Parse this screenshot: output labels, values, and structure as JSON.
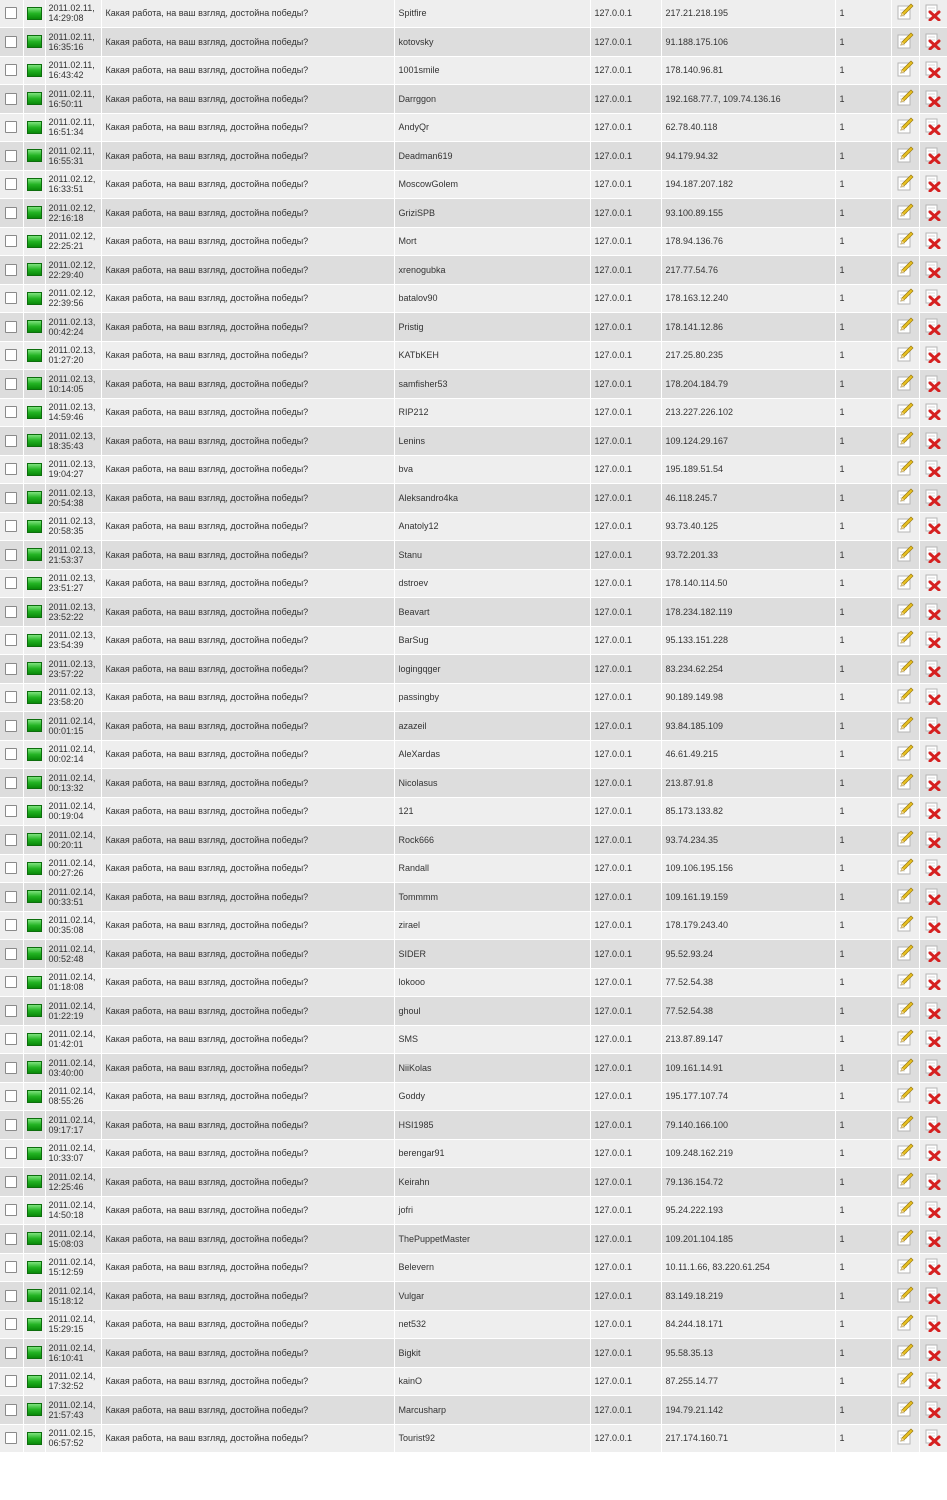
{
  "question": "Какая работа, на ваш взгляд, достойна победы?",
  "server_ip": "127.0.0.1",
  "icons": {
    "status": "green-status-icon",
    "edit": "edit-pencil-icon",
    "delete": "delete-cross-icon"
  },
  "colors": {
    "row_odd": "#eeeeee",
    "row_even": "#dddddd",
    "status_green": "#22b322",
    "delete_red": "#d62020",
    "pencil_yellow": "#e8c020"
  },
  "rows": [
    {
      "date": "2011.02.11,",
      "time": "14:29:08",
      "user": "Spitfire",
      "ip": "217.21.218.195",
      "count": "1"
    },
    {
      "date": "2011.02.11,",
      "time": "16:35:16",
      "user": "kotovsky",
      "ip": "91.188.175.106",
      "count": "1"
    },
    {
      "date": "2011.02.11,",
      "time": "16:43:42",
      "user": "1001smile",
      "ip": "178.140.96.81",
      "count": "1"
    },
    {
      "date": "2011.02.11,",
      "time": "16:50:11",
      "user": "Darrggon",
      "ip": "192.168.77.7, 109.74.136.16",
      "count": "1"
    },
    {
      "date": "2011.02.11,",
      "time": "16:51:34",
      "user": "AndyQr",
      "ip": "62.78.40.118",
      "count": "1"
    },
    {
      "date": "2011.02.11,",
      "time": "16:55:31",
      "user": "Deadman619",
      "ip": "94.179.94.32",
      "count": "1"
    },
    {
      "date": "2011.02.12,",
      "time": "16:33:51",
      "user": "MoscowGolem",
      "ip": "194.187.207.182",
      "count": "1"
    },
    {
      "date": "2011.02.12,",
      "time": "22:16:18",
      "user": "GriziSPB",
      "ip": "93.100.89.155",
      "count": "1"
    },
    {
      "date": "2011.02.12,",
      "time": "22:25:21",
      "user": "Mort",
      "ip": "178.94.136.76",
      "count": "1"
    },
    {
      "date": "2011.02.12,",
      "time": "22:29:40",
      "user": "xrenogubka",
      "ip": "217.77.54.76",
      "count": "1"
    },
    {
      "date": "2011.02.12,",
      "time": "22:39:56",
      "user": "batalov90",
      "ip": "178.163.12.240",
      "count": "1"
    },
    {
      "date": "2011.02.13,",
      "time": "00:42:24",
      "user": "Pristig",
      "ip": "178.141.12.86",
      "count": "1"
    },
    {
      "date": "2011.02.13,",
      "time": "01:27:20",
      "user": "KATbKEH",
      "ip": "217.25.80.235",
      "count": "1"
    },
    {
      "date": "2011.02.13,",
      "time": "10:14:05",
      "user": "samfisher53",
      "ip": "178.204.184.79",
      "count": "1"
    },
    {
      "date": "2011.02.13,",
      "time": "14:59:46",
      "user": "RIP212",
      "ip": "213.227.226.102",
      "count": "1"
    },
    {
      "date": "2011.02.13,",
      "time": "18:35:43",
      "user": "Lenins",
      "ip": "109.124.29.167",
      "count": "1"
    },
    {
      "date": "2011.02.13,",
      "time": "19:04:27",
      "user": "bva",
      "ip": "195.189.51.54",
      "count": "1"
    },
    {
      "date": "2011.02.13,",
      "time": "20:54:38",
      "user": "Aleksandro4ka",
      "ip": "46.118.245.7",
      "count": "1"
    },
    {
      "date": "2011.02.13,",
      "time": "20:58:35",
      "user": "Anatoly12",
      "ip": "93.73.40.125",
      "count": "1"
    },
    {
      "date": "2011.02.13,",
      "time": "21:53:37",
      "user": "Stanu",
      "ip": "93.72.201.33",
      "count": "1"
    },
    {
      "date": "2011.02.13,",
      "time": "23:51:27",
      "user": "dstroev",
      "ip": "178.140.114.50",
      "count": "1"
    },
    {
      "date": "2011.02.13,",
      "time": "23:52:22",
      "user": "Beavart",
      "ip": "178.234.182.119",
      "count": "1"
    },
    {
      "date": "2011.02.13,",
      "time": "23:54:39",
      "user": "BarSug",
      "ip": "95.133.151.228",
      "count": "1"
    },
    {
      "date": "2011.02.13,",
      "time": "23:57:22",
      "user": "logingqger",
      "ip": "83.234.62.254",
      "count": "1"
    },
    {
      "date": "2011.02.13,",
      "time": "23:58:20",
      "user": "passingby",
      "ip": "90.189.149.98",
      "count": "1"
    },
    {
      "date": "2011.02.14,",
      "time": "00:01:15",
      "user": "azazeil",
      "ip": "93.84.185.109",
      "count": "1"
    },
    {
      "date": "2011.02.14,",
      "time": "00:02:14",
      "user": "AleXardas",
      "ip": "46.61.49.215",
      "count": "1"
    },
    {
      "date": "2011.02.14,",
      "time": "00:13:32",
      "user": "Nicolasus",
      "ip": "213.87.91.8",
      "count": "1"
    },
    {
      "date": "2011.02.14,",
      "time": "00:19:04",
      "user": "121",
      "ip": "85.173.133.82",
      "count": "1"
    },
    {
      "date": "2011.02.14,",
      "time": "00:20:11",
      "user": "Rock666",
      "ip": "93.74.234.35",
      "count": "1"
    },
    {
      "date": "2011.02.14,",
      "time": "00:27:26",
      "user": "Randall",
      "ip": "109.106.195.156",
      "count": "1"
    },
    {
      "date": "2011.02.14,",
      "time": "00:33:51",
      "user": "Tommmm",
      "ip": "109.161.19.159",
      "count": "1"
    },
    {
      "date": "2011.02.14,",
      "time": "00:35:08",
      "user": "zirael",
      "ip": "178.179.243.40",
      "count": "1"
    },
    {
      "date": "2011.02.14,",
      "time": "00:52:48",
      "user": "SIDER",
      "ip": "95.52.93.24",
      "count": "1"
    },
    {
      "date": "2011.02.14,",
      "time": "01:18:08",
      "user": "lokooo",
      "ip": "77.52.54.38",
      "count": "1"
    },
    {
      "date": "2011.02.14,",
      "time": "01:22:19",
      "user": "ghoul",
      "ip": "77.52.54.38",
      "count": "1"
    },
    {
      "date": "2011.02.14,",
      "time": "01:42:01",
      "user": "SMS",
      "ip": "213.87.89.147",
      "count": "1"
    },
    {
      "date": "2011.02.14,",
      "time": "03:40:00",
      "user": "NiiKolas",
      "ip": "109.161.14.91",
      "count": "1"
    },
    {
      "date": "2011.02.14,",
      "time": "08:55:26",
      "user": "Goddy",
      "ip": "195.177.107.74",
      "count": "1"
    },
    {
      "date": "2011.02.14,",
      "time": "09:17:17",
      "user": "HSI1985",
      "ip": "79.140.166.100",
      "count": "1"
    },
    {
      "date": "2011.02.14,",
      "time": "10:33:07",
      "user": "berengar91",
      "ip": "109.248.162.219",
      "count": "1"
    },
    {
      "date": "2011.02.14,",
      "time": "12:25:46",
      "user": "Keirahn",
      "ip": "79.136.154.72",
      "count": "1"
    },
    {
      "date": "2011.02.14,",
      "time": "14:50:18",
      "user": "jofri",
      "ip": "95.24.222.193",
      "count": "1"
    },
    {
      "date": "2011.02.14,",
      "time": "15:08:03",
      "user": "ThePuppetMaster",
      "ip": "109.201.104.185",
      "count": "1"
    },
    {
      "date": "2011.02.14,",
      "time": "15:12:59",
      "user": "Belevern",
      "ip": "10.11.1.66, 83.220.61.254",
      "count": "1"
    },
    {
      "date": "2011.02.14,",
      "time": "15:18:12",
      "user": "Vulgar",
      "ip": "83.149.18.219",
      "count": "1"
    },
    {
      "date": "2011.02.14,",
      "time": "15:29:15",
      "user": "net532",
      "ip": "84.244.18.171",
      "count": "1"
    },
    {
      "date": "2011.02.14,",
      "time": "16:10:41",
      "user": "Bigkit",
      "ip": "95.58.35.13",
      "count": "1"
    },
    {
      "date": "2011.02.14,",
      "time": "17:32:52",
      "user": "kainO",
      "ip": "87.255.14.77",
      "count": "1"
    },
    {
      "date": "2011.02.14,",
      "time": "21:57:43",
      "user": "Marcusharp",
      "ip": "194.79.21.142",
      "count": "1"
    },
    {
      "date": "2011.02.15,",
      "time": "06:57:52",
      "user": "Tourist92",
      "ip": "217.174.160.71",
      "count": "1"
    }
  ]
}
